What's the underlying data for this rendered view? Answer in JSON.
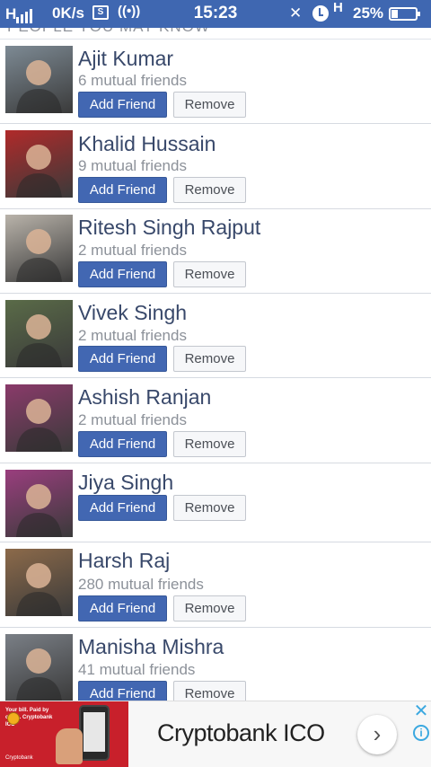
{
  "status_bar": {
    "network_label": "H",
    "speed": "0K/s",
    "time": "15:23",
    "network_type": "H",
    "battery_percent": "25%",
    "battery_level": 0.25,
    "icons": [
      "signal-icon",
      "sim-icon",
      "wifi-wave-icon",
      "mute-icon",
      "alarm-icon",
      "battery-icon"
    ]
  },
  "section_header": "PEOPLE YOU MAY KNOW",
  "buttons": {
    "add_label": "Add Friend",
    "remove_label": "Remove"
  },
  "people": [
    {
      "name": "Ajit Kumar",
      "mutual": "6 mutual friends",
      "avatar_color": "#7d8a94"
    },
    {
      "name": "Khalid Hussain",
      "mutual": "9 mutual friends",
      "avatar_color": "#b02a2a"
    },
    {
      "name": "Ritesh Singh Rajput",
      "mutual": "2 mutual friends",
      "avatar_color": "#b9b3aa"
    },
    {
      "name": "Vivek Singh",
      "mutual": "2 mutual friends",
      "avatar_color": "#5a6b48"
    },
    {
      "name": "Ashish Ranjan",
      "mutual": "2 mutual friends",
      "avatar_color": "#8a3a6a"
    },
    {
      "name": "Jiya Singh",
      "mutual": "",
      "avatar_color": "#9a3e7e"
    },
    {
      "name": "Harsh Raj",
      "mutual": "280 mutual friends",
      "avatar_color": "#8c6a4a"
    },
    {
      "name": "Manisha Mishra",
      "mutual": "41 mutual friends",
      "avatar_color": "#7a7f86"
    }
  ],
  "ad": {
    "title": "Cryptobank ICO",
    "image_tagline": "Your bill. Paid by coins. Cryptobank ICO",
    "image_footer": "Cryptobank",
    "next_icon": "chevron-right-icon",
    "close_icon": "close-icon",
    "info_icon": "info-icon",
    "accent": "#3ba8e0"
  }
}
